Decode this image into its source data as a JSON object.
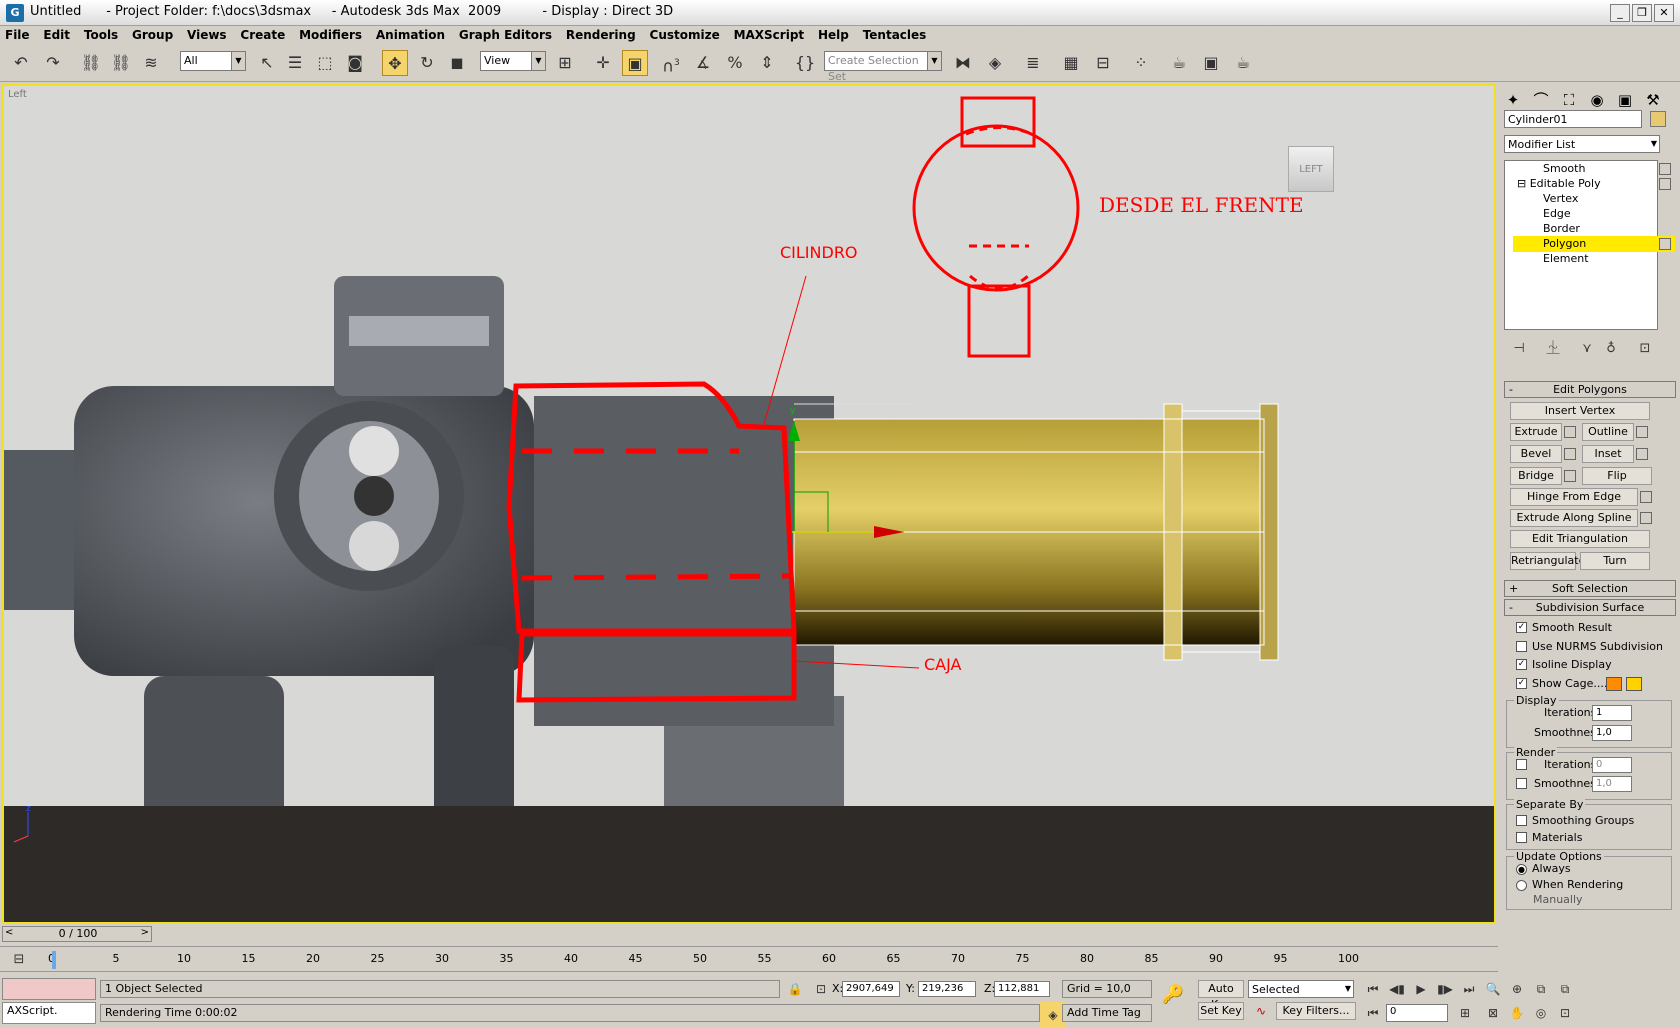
{
  "titlebar": {
    "title": "Untitled      - Project Folder: f:\\docs\\3dsmax     - Autodesk 3ds Max  2009          - Display : Direct 3D",
    "app_icon": "G",
    "minimize": "_",
    "restore": "❐",
    "close": "✕"
  },
  "menu": [
    "File",
    "Edit",
    "Tools",
    "Group",
    "Views",
    "Create",
    "Modifiers",
    "Animation",
    "Graph Editors",
    "Rendering",
    "Customize",
    "MAXScript",
    "Help",
    "Tentacles"
  ],
  "toolbar": {
    "filter_select": "All",
    "refcoord_select": "View",
    "selection_set_placeholder": "Create Selection Set",
    "snap_label": "3"
  },
  "viewport": {
    "label": "Left",
    "viewcube": "LEFT",
    "annotations": {
      "front": "DESDE EL FRENTE",
      "cylinder": "CILINDRO",
      "box": "CAJA"
    },
    "axis_y": "y",
    "axis_z": "z"
  },
  "command_panel": {
    "object_name": "Cylinder01",
    "modifier_list": "Modifier List",
    "stack": [
      {
        "label": "Smooth"
      },
      {
        "label": "Editable Poly"
      },
      {
        "label": "Vertex"
      },
      {
        "label": "Edge"
      },
      {
        "label": "Border"
      },
      {
        "label": "Polygon"
      },
      {
        "label": "Element"
      }
    ],
    "edit_polygons": {
      "header": "Edit Polygons",
      "insert_vertex": "Insert Vertex",
      "extrude": "Extrude",
      "outline": "Outline",
      "bevel": "Bevel",
      "inset": "Inset",
      "bridge": "Bridge",
      "flip": "Flip",
      "hinge": "Hinge From Edge",
      "extrude_spline": "Extrude Along Spline",
      "edit_tri": "Edit Triangulation",
      "retriangulate": "Retriangulate",
      "turn": "Turn"
    },
    "soft_selection": {
      "header": "Soft Selection",
      "toggle": "+"
    },
    "subdivision": {
      "header": "Subdivision Surface",
      "toggle": "-",
      "smooth_result": "Smooth Result",
      "use_nurms": "Use NURMS Subdivision",
      "isoline": "Isoline Display",
      "show_cage": "Show Cage......",
      "display_group": "Display",
      "iterations_label": "Iterations:",
      "iterations": "1",
      "smoothness_label": "Smoothness:",
      "smoothness": "1,0",
      "render_group": "Render",
      "r_iterations_label": "Iterations:",
      "r_iterations": "0",
      "r_smoothness_label": "Smoothness:",
      "r_smoothness": "1,0",
      "separate_group": "Separate By",
      "smoothing_groups": "Smoothing Groups",
      "materials": "Materials",
      "update_group": "Update Options",
      "always": "Always",
      "when_rendering": "When Rendering",
      "manually": "Manually"
    },
    "ep_toggle": "-"
  },
  "timeline": {
    "slider": "0 / 100",
    "ticks": [
      "0",
      "5",
      "10",
      "15",
      "20",
      "25",
      "30",
      "35",
      "40",
      "45",
      "50",
      "55",
      "60",
      "65",
      "70",
      "75",
      "80",
      "85",
      "90",
      "95",
      "100"
    ]
  },
  "status": {
    "maxscript": "AXScript.",
    "selected": "1 Object Selected",
    "render_time": "Rendering Time  0:00:02",
    "x_label": "X:",
    "x": "2907,649",
    "y_label": "Y:",
    "y": "219,236",
    "z_label": "Z:",
    "z": "112,881",
    "grid": "Grid = 10,0",
    "add_time_tag": "Add Time Tag",
    "auto_key": "Auto Key",
    "set_key": "Set Key",
    "selected_select": "Selected",
    "key_filters": "Key Filters...",
    "frame": "0"
  },
  "colors": {
    "annotation": "#ff0000",
    "selection": "#ffea00",
    "cage1": "#ff8c00",
    "cage2": "#ffd200",
    "cylinder": "#c8b040"
  }
}
